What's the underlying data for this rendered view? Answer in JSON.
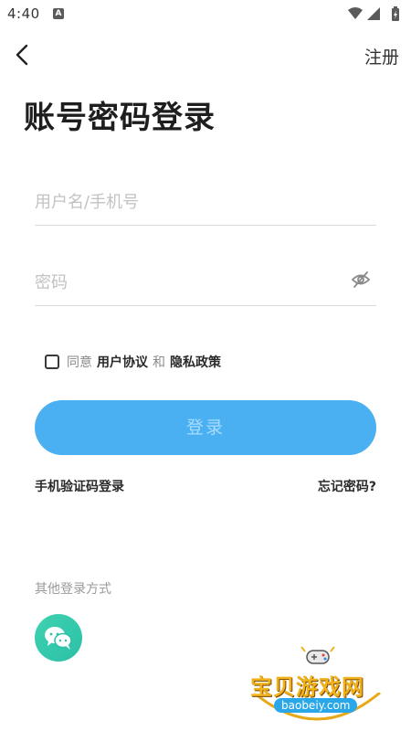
{
  "status_bar": {
    "time": "4:40",
    "notification_badge": "A",
    "icons": [
      "wifi-icon",
      "signal-icon",
      "battery-icon"
    ]
  },
  "nav": {
    "back_icon": "chevron-left-icon",
    "register_label": "注册"
  },
  "title": "账号密码登录",
  "form": {
    "username_placeholder": "用户名/手机号",
    "username_value": "",
    "password_placeholder": "密码",
    "password_value": "",
    "password_toggle_icon": "eye-off-icon"
  },
  "agreement": {
    "checked": false,
    "prefix": "同意",
    "user_agreement": "用户协议",
    "and": "和",
    "privacy_policy": "隐私政策"
  },
  "login_button": "登录",
  "sms_login": "手机验证码登录",
  "forgot_password": "忘记密码?",
  "other_login_label": "其他登录方式",
  "other_login_methods": [
    "wechat-icon"
  ],
  "watermark": {
    "site_name": "宝贝游戏网",
    "url": "baobeiy.com"
  },
  "colors": {
    "primary_button": "#4ab0f2",
    "primary_button_text": "#a8dcff",
    "wechat": "#3fd3b0",
    "watermark_gold": "#f1b21c"
  }
}
